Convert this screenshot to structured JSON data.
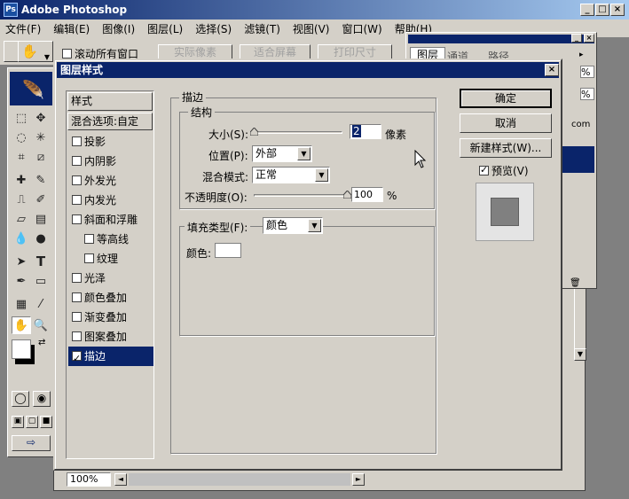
{
  "app": {
    "title": "Adobe Photoshop",
    "icon": "ps-logo-icon"
  },
  "menu": [
    "文件(F)",
    "编辑(E)",
    "图像(I)",
    "图层(L)",
    "选择(S)",
    "滤镜(T)",
    "视图(V)",
    "窗口(W)",
    "帮助(H)"
  ],
  "options": {
    "scroll_all": "滚动所有窗口",
    "actual_pixels": "实际像素",
    "fit_screen": "适合屏幕",
    "print_size": "打印尺寸"
  },
  "panel": {
    "tabs": [
      "图层",
      "通道",
      "路径"
    ],
    "fragments": [
      "%",
      "%",
      "com"
    ]
  },
  "doc": {
    "zoom": "100%"
  },
  "dialog": {
    "title": "图层样式",
    "styles_header": "样式",
    "blend_options": "混合选项:自定",
    "effects": [
      {
        "label": "投影",
        "checked": false,
        "indent": false
      },
      {
        "label": "内阴影",
        "checked": false,
        "indent": false
      },
      {
        "label": "外发光",
        "checked": false,
        "indent": false
      },
      {
        "label": "内发光",
        "checked": false,
        "indent": false
      },
      {
        "label": "斜面和浮雕",
        "checked": false,
        "indent": false
      },
      {
        "label": "等高线",
        "checked": false,
        "indent": true
      },
      {
        "label": "纹理",
        "checked": false,
        "indent": true
      },
      {
        "label": "光泽",
        "checked": false,
        "indent": false
      },
      {
        "label": "颜色叠加",
        "checked": false,
        "indent": false
      },
      {
        "label": "渐变叠加",
        "checked": false,
        "indent": false
      },
      {
        "label": "图案叠加",
        "checked": false,
        "indent": false
      },
      {
        "label": "描边",
        "checked": true,
        "indent": false,
        "selected": true
      }
    ],
    "stroke": {
      "group_title": "描边",
      "structure_title": "结构",
      "size_label": "大小(S):",
      "size_value": "2",
      "size_unit": "像素",
      "size_slider_fraction": 0.0,
      "position_label": "位置(P):",
      "position_value": "外部",
      "blend_label": "混合模式:",
      "blend_value": "正常",
      "opacity_label": "不透明度(O):",
      "opacity_value": "100",
      "opacity_unit": "%",
      "opacity_slider_fraction": 1.0,
      "fill_type_label": "填充类型(F):",
      "fill_type_value": "颜色",
      "color_label": "颜色:",
      "color_value": "#ffffff"
    },
    "buttons": {
      "ok": "确定",
      "cancel": "取消",
      "new_style": "新建样式(W)...",
      "preview": "预览(V)"
    },
    "preview_checked": true,
    "colors": {
      "title_bar": "#0a246a",
      "selected_row": "#0a246a",
      "preview_swatch": "#808080"
    }
  }
}
